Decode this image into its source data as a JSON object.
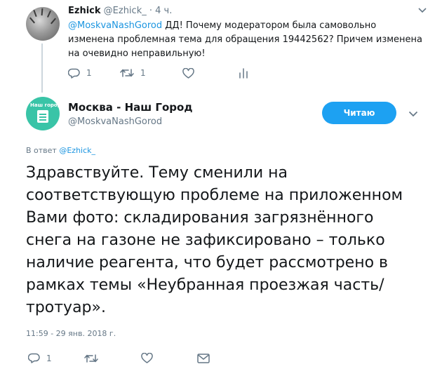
{
  "parent_tweet": {
    "name": "Ezhick",
    "handle": "@Ezhick_",
    "separator": "·",
    "time": "4 ч.",
    "mention": "@MoskvaNashGorod",
    "text": " ДД! Почему модератором была самовольно изменена проблемная тема для обращения 19442562? Причем изменена на очевидно неправильную!",
    "reply_count": "1",
    "retweet_count": "1"
  },
  "main_tweet": {
    "name": "Москва - Наш Город",
    "handle": "@MoskvaNashGorod",
    "avatar_label": "Наш город",
    "follow_label": "Читаю",
    "reply_prefix": "В ответ ",
    "reply_to": "@Ezhick_",
    "text": "Здравствуйте. Тему сменили на соответствующую проблеме на приложенном Вами фото: складирования загрязнённого снега на газоне не зафиксировано – только наличие реагента, что будет рассмотрено в рамках темы «Неубранная проезжая часть/тротуар».",
    "timestamp": "11:59 - 29 янв. 2018 г.",
    "reply_count": "1"
  },
  "colors": {
    "accent": "#1da1f2",
    "link": "#1b95e0",
    "secondary_text": "#657786",
    "avatar_bg": "#39c4a7",
    "thread_line": "#ccd6dd"
  },
  "icons": [
    "reply-icon",
    "retweet-icon",
    "like-icon",
    "analytics-icon",
    "direct-message-icon",
    "chevron-down-icon"
  ]
}
